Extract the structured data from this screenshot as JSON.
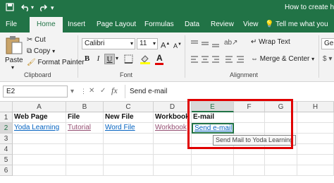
{
  "titlebar": {
    "save_icon": "save-icon",
    "undo_icon": "undo-icon",
    "redo_icon": "redo-icon",
    "title": "How to create hype"
  },
  "menu": {
    "tabs": [
      "File",
      "Home",
      "Insert",
      "Page Layout",
      "Formulas",
      "Data",
      "Review",
      "View"
    ],
    "tell_me": "Tell me what you",
    "active": "Home"
  },
  "ribbon": {
    "clipboard": {
      "paste": "Paste",
      "cut": "Cut",
      "copy": "Copy",
      "format_painter": "Format Painter",
      "label": "Clipboard"
    },
    "font": {
      "name": "Calibri",
      "size": "11",
      "bold": "B",
      "italic": "I",
      "underline": "U",
      "label": "Font"
    },
    "alignment": {
      "wrap": "Wrap Text",
      "merge": "Merge & Center",
      "label": "Alignment"
    },
    "number": {
      "format": "Generi"
    }
  },
  "formula_bar": {
    "name_box": "E2",
    "fx": "fx",
    "content": "Send e-mail"
  },
  "sheet": {
    "columns": [
      "A",
      "B",
      "C",
      "D",
      "E",
      "F",
      "G",
      "H"
    ],
    "rows": [
      "1",
      "2",
      "3",
      "4",
      "5",
      "6"
    ],
    "row1": {
      "A": "Web Page",
      "B": "File",
      "C": "New File",
      "D": "Workbook",
      "E": "E-mail"
    },
    "row2": {
      "A": "Yoda Learning",
      "B": "Tutorial",
      "C": "Word File",
      "D": "Workbook",
      "E": "Send e-mail"
    },
    "tooltip": "Send Mail to Yoda Learning",
    "selected_cell": "E2",
    "highlight_color": "#e00000"
  }
}
